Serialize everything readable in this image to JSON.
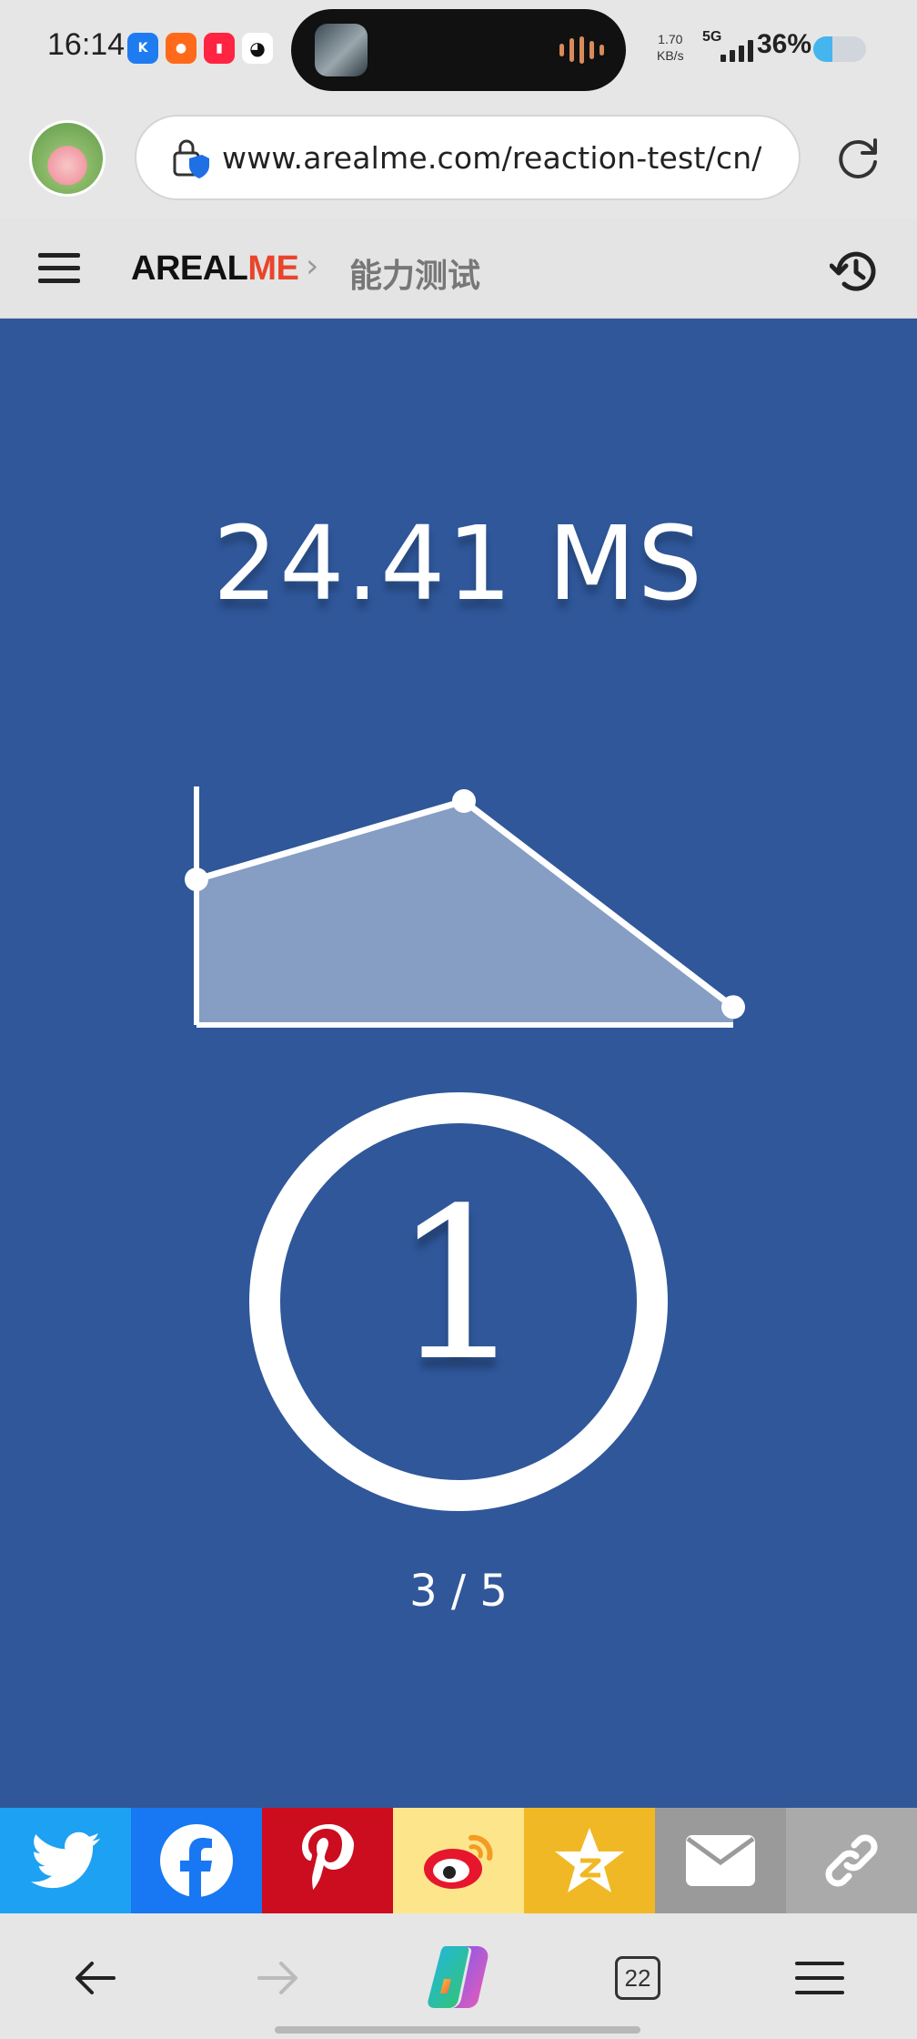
{
  "status_bar": {
    "time": "16:14",
    "net_speed": "1.70",
    "net_unit": "KB/s",
    "network": "5G",
    "battery_percent": "36%",
    "battery_level": 0.36,
    "app_icons": [
      "kugou-icon",
      "taobao-icon",
      "xiaohongshu-icon",
      "qq-icon"
    ]
  },
  "browser": {
    "url": "www.arealme.com/reaction-test/cn/"
  },
  "site": {
    "brand_a": "AREAL",
    "brand_b": "ME",
    "breadcrumb_separator": "›",
    "breadcrumb": "能力测试",
    "brand_accent_color": "#e8452c"
  },
  "test": {
    "result": "24.41 MS",
    "countdown": "1",
    "progress": "3 / 5",
    "background_color": "#2f579a"
  },
  "chart_data": {
    "type": "area",
    "x": [
      1,
      2,
      3
    ],
    "values": [
      0.65,
      1.0,
      0.08
    ],
    "title": "",
    "xlabel": "",
    "ylabel": "",
    "note_values_relative": true
  },
  "share_bar": [
    {
      "name": "twitter",
      "color": "#1da1f2"
    },
    {
      "name": "facebook",
      "color": "#1877f2"
    },
    {
      "name": "pinterest",
      "color": "#cb0d1f"
    },
    {
      "name": "weibo",
      "color": "#fde58c"
    },
    {
      "name": "qzone",
      "color": "#f0b825"
    },
    {
      "name": "email",
      "color": "#9a9a9a"
    },
    {
      "name": "copy-link",
      "color": "#aaaaaa"
    }
  ],
  "bottom_nav": {
    "tab_count": "22"
  }
}
